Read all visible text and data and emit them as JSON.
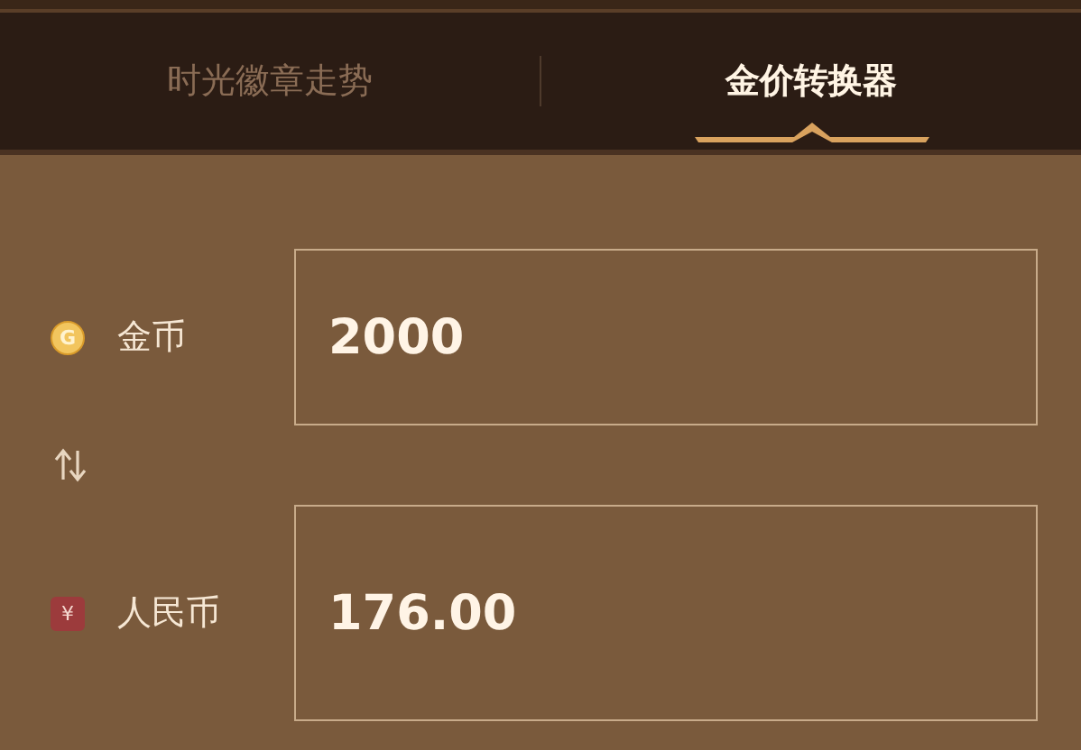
{
  "tabs": [
    {
      "label": "时光徽章走势",
      "selected": false
    },
    {
      "label": "金价转换器",
      "selected": true
    }
  ],
  "converter": [
    {
      "kind": "coin",
      "symbol": "G",
      "label": "金币",
      "value": "2000"
    },
    {
      "kind": "currency",
      "symbol": "¥",
      "label": "人民币",
      "value": "176.00"
    }
  ]
}
